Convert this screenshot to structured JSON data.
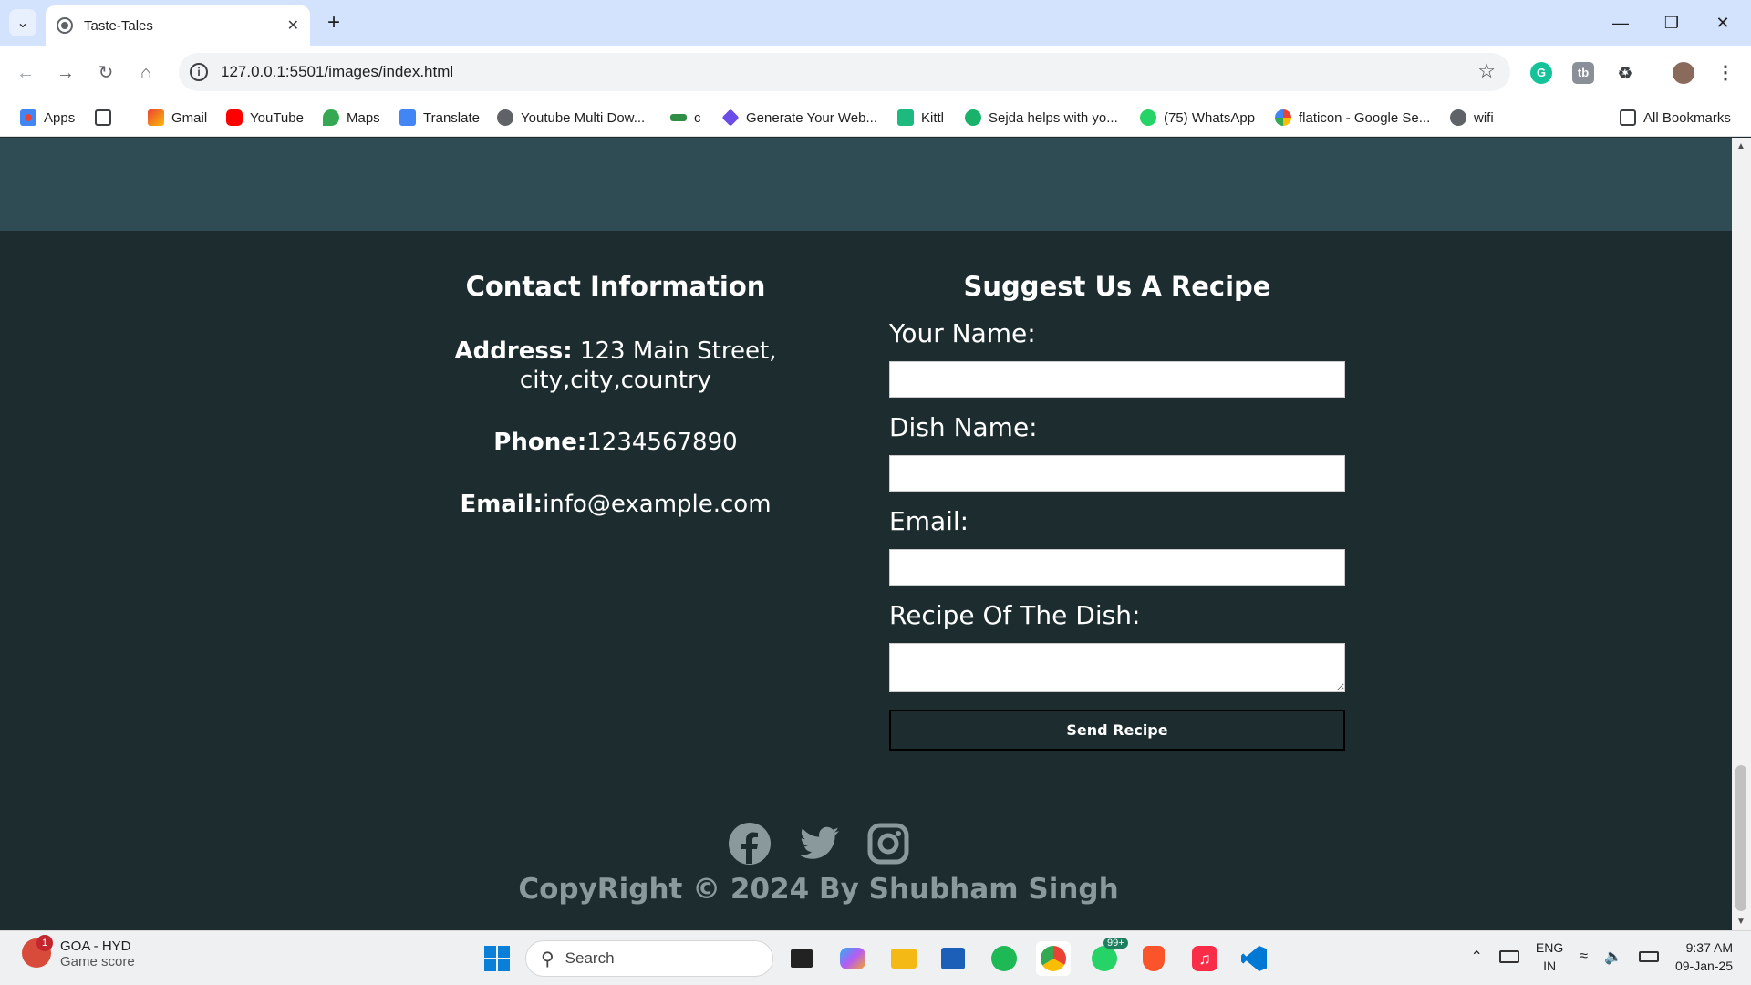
{
  "browser": {
    "tab_title": "Taste-Tales",
    "url": "127.0.0.1:5501/images/index.html",
    "bookmarks": [
      {
        "label": "Apps",
        "icon": "apps-grid-icon"
      },
      {
        "label": "",
        "icon": "tab-groups-icon"
      },
      {
        "label": "Gmail",
        "icon": "gmail-icon"
      },
      {
        "label": "YouTube",
        "icon": "youtube-icon"
      },
      {
        "label": "Maps",
        "icon": "maps-icon"
      },
      {
        "label": "Translate",
        "icon": "translate-icon"
      },
      {
        "label": "Youtube Multi Dow...",
        "icon": "globe-icon"
      },
      {
        "label": "c",
        "icon": "geeksforgeeks-icon"
      },
      {
        "label": "Generate Your Web...",
        "icon": "diamond-icon"
      },
      {
        "label": "Kittl",
        "icon": "kittl-icon"
      },
      {
        "label": "Sejda helps with yo...",
        "icon": "sejda-icon"
      },
      {
        "label": "(75) WhatsApp",
        "icon": "whatsapp-icon"
      },
      {
        "label": "flaticon - Google Se...",
        "icon": "google-icon"
      },
      {
        "label": "wifi",
        "icon": "globe-icon"
      }
    ],
    "all_bookmarks": "All Bookmarks"
  },
  "contact": {
    "heading": "Contact Information",
    "address_label": "Address:",
    "address_value": " 123 Main Street, city,city,country",
    "phone_label": "Phone:",
    "phone_value": "1234567890",
    "email_label": "Email:",
    "email_value": "info@example.com"
  },
  "form": {
    "heading": "Suggest Us A Recipe",
    "name_label": "Your Name:",
    "dish_label": "Dish Name:",
    "email_label": "Email:",
    "recipe_label": "Recipe Of The Dish:",
    "submit_label": "Send Recipe"
  },
  "footer": {
    "copyright": "CopyRight © 2024 By Shubham Singh",
    "social": [
      "facebook-icon",
      "twitter-icon",
      "instagram-icon"
    ]
  },
  "taskbar": {
    "weather_title": "GOA - HYD",
    "weather_sub": "Game score",
    "weather_badge": "1",
    "search_placeholder": "Search",
    "whatsapp_badge": "99+",
    "lang_line1": "ENG",
    "lang_line2": "IN",
    "time": "9:37 AM",
    "date": "09-Jan-25"
  }
}
